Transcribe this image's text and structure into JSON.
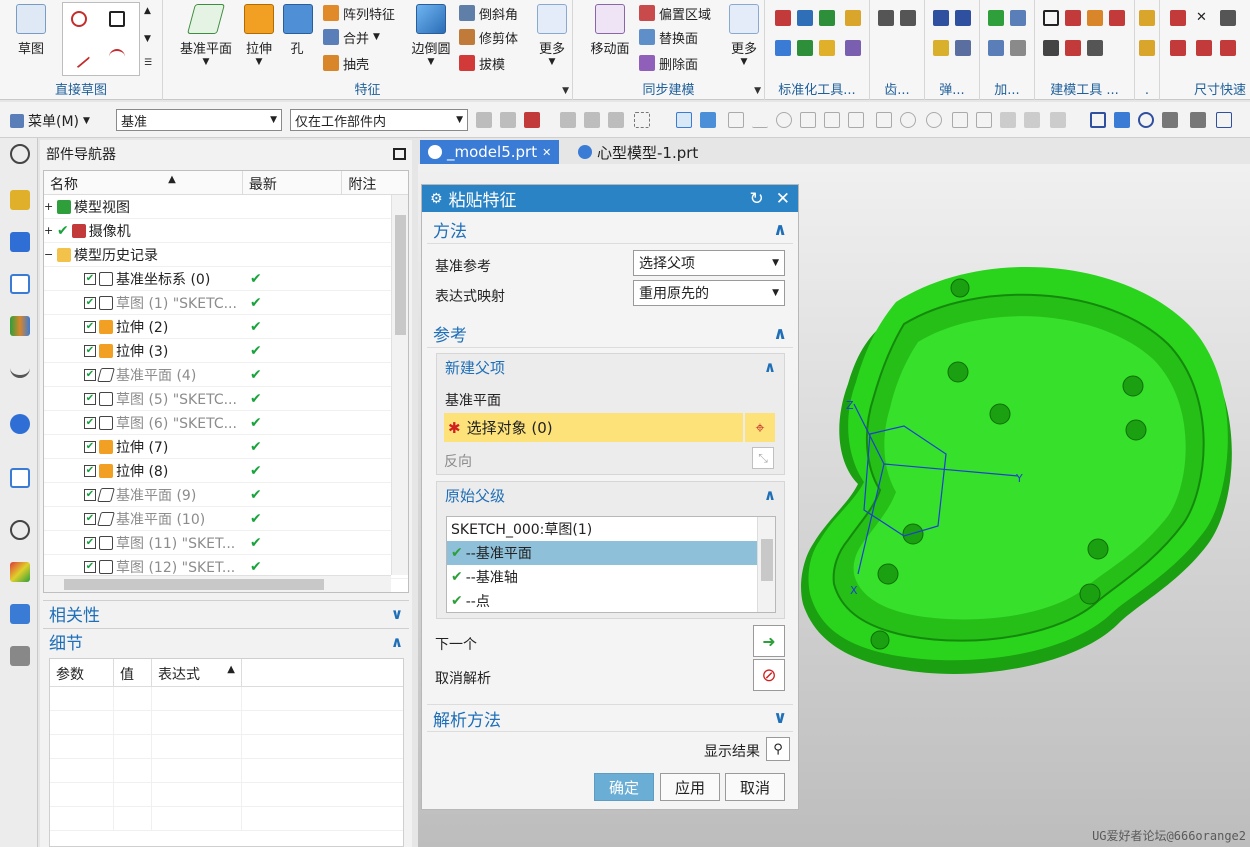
{
  "ribbon": {
    "groups": [
      {
        "label": "直接草图"
      },
      {
        "label": "特征"
      },
      {
        "label": "同步建模"
      },
      {
        "label": "标准化工具..."
      },
      {
        "label": "齿..."
      },
      {
        "label": "弹..."
      },
      {
        "label": "加..."
      },
      {
        "label": "建模工具 ..."
      },
      {
        "label": "."
      },
      {
        "label": "尺寸快速"
      }
    ],
    "sketch_label": "草图",
    "datum_plane": "基准平面",
    "extrude": "拉伸",
    "hole": "孔",
    "pattern_feature": "阵列特征",
    "unite": "合并",
    "shell": "抽壳",
    "edge_blend": "边倒圆",
    "chamfer": "倒斜角",
    "trim_body": "修剪体",
    "draft": "拔模",
    "more1": "更多",
    "move_face": "移动面",
    "offset_region": "偏置区域",
    "replace_face": "替换面",
    "delete_face": "删除面",
    "more2": "更多"
  },
  "toolbar2": {
    "menu_label": "菜单(M)",
    "filter_value": "基准",
    "scope_value": "仅在工作部件内"
  },
  "navigator": {
    "title": "部件导航器",
    "col_name": "名称",
    "col_latest": "最新",
    "col_note": "附注",
    "rows": [
      {
        "label": "模型视图",
        "check": ""
      },
      {
        "label": "摄像机",
        "check": ""
      },
      {
        "label": "模型历史记录",
        "check": ""
      },
      {
        "label": "基准坐标系 (0)",
        "check": "✔"
      },
      {
        "label": "草图 (1) \"SKETC...",
        "check": "✔"
      },
      {
        "label": "拉伸 (2)",
        "check": "✔"
      },
      {
        "label": "拉伸 (3)",
        "check": "✔"
      },
      {
        "label": "基准平面 (4)",
        "check": "✔"
      },
      {
        "label": "草图 (5) \"SKETC...",
        "check": "✔"
      },
      {
        "label": "草图 (6) \"SKETC...",
        "check": "✔"
      },
      {
        "label": "拉伸 (7)",
        "check": "✔"
      },
      {
        "label": "拉伸 (8)",
        "check": "✔"
      },
      {
        "label": "基准平面 (9)",
        "check": "✔"
      },
      {
        "label": "基准平面 (10)",
        "check": "✔"
      },
      {
        "label": "草图 (11) \"SKET...",
        "check": "✔"
      },
      {
        "label": "草图 (12) \"SKET...",
        "check": "✔"
      }
    ],
    "dependencies": "相关性",
    "details": "细节",
    "detail_cols": [
      "参数",
      "值",
      "表达式"
    ]
  },
  "tabs": [
    "_model5.prt",
    "心型模型-1.prt"
  ],
  "dialog": {
    "title": "粘贴特征",
    "method_section": "方法",
    "datum_ref_label": "基准参考",
    "datum_ref_value": "选择父项",
    "expr_map_label": "表达式映射",
    "expr_map_value": "重用原先的",
    "ref_section": "参考",
    "new_parent": "新建父项",
    "datum_plane_label": "基准平面",
    "select_object": "选择对象 (0)",
    "reverse": "反向",
    "orig_parent": "原始父级",
    "orig_list": [
      "SKETCH_000:草图(1)",
      "--基准平面",
      "--基准轴",
      "--点"
    ],
    "next": "下一个",
    "cancel_resolve": "取消解析",
    "resolve_method": "解析方法",
    "show_result": "显示结果",
    "ok": "确定",
    "apply": "应用",
    "cancel": "取消"
  },
  "watermark": "UG爱好者论坛@666orange2",
  "colors": {
    "accent": "#2a83c4",
    "model": "#2bd41c",
    "select_row": "#fde27a"
  }
}
